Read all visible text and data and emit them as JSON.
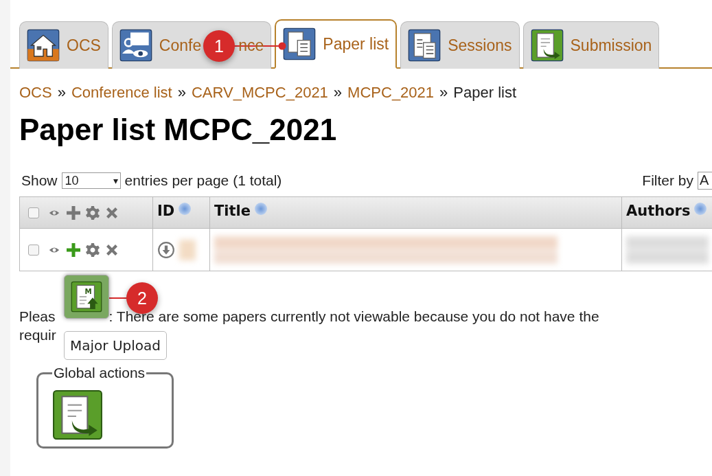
{
  "tabs": [
    {
      "label_parts": [
        "OCS"
      ],
      "selected": false
    },
    {
      "label_parts": [
        "Confe",
        "nce"
      ],
      "selected": false
    },
    {
      "label_parts": [
        "Paper list"
      ],
      "selected": true
    },
    {
      "label_parts": [
        "Sessions"
      ],
      "selected": false
    },
    {
      "label_parts": [
        "Submission"
      ],
      "selected": false
    }
  ],
  "breadcrumb": [
    "OCS",
    "Conference list",
    "CARV_MCPC_2021",
    "MCPC_2021",
    "Paper list"
  ],
  "breadcrumb_separator": "»",
  "heading": "Paper list MCPC_2021",
  "length_menu": {
    "before": "Show",
    "value": "10",
    "caret": "▾",
    "after": "entries per page (1 total)"
  },
  "filter": {
    "label": "Filter by",
    "value": "A"
  },
  "table": {
    "columns": [
      "ID",
      "Title",
      "Authors"
    ],
    "select_all_checked": false,
    "header_actions": [
      {
        "kind": "eye",
        "active": false
      },
      {
        "kind": "plus",
        "active": false
      },
      {
        "kind": "gear",
        "active": false
      },
      {
        "kind": "cross",
        "active": false
      }
    ],
    "rows": [
      {
        "checked": false,
        "actions": [
          {
            "kind": "eye",
            "active": false
          },
          {
            "kind": "plus",
            "active": true
          },
          {
            "kind": "gear",
            "active": false
          },
          {
            "kind": "cross",
            "active": false
          }
        ]
      }
    ]
  },
  "notice": {
    "line_1": [
      "Pleas",
      ": There are some papers currently not viewable because you do not have the"
    ],
    "line_2": "requir"
  },
  "popup": {
    "tooltip": "Major Upload",
    "icon_letter": "M"
  },
  "global_actions": {
    "legend": "Global actions"
  },
  "callouts": [
    {
      "number": "1"
    },
    {
      "number": "2"
    }
  ]
}
